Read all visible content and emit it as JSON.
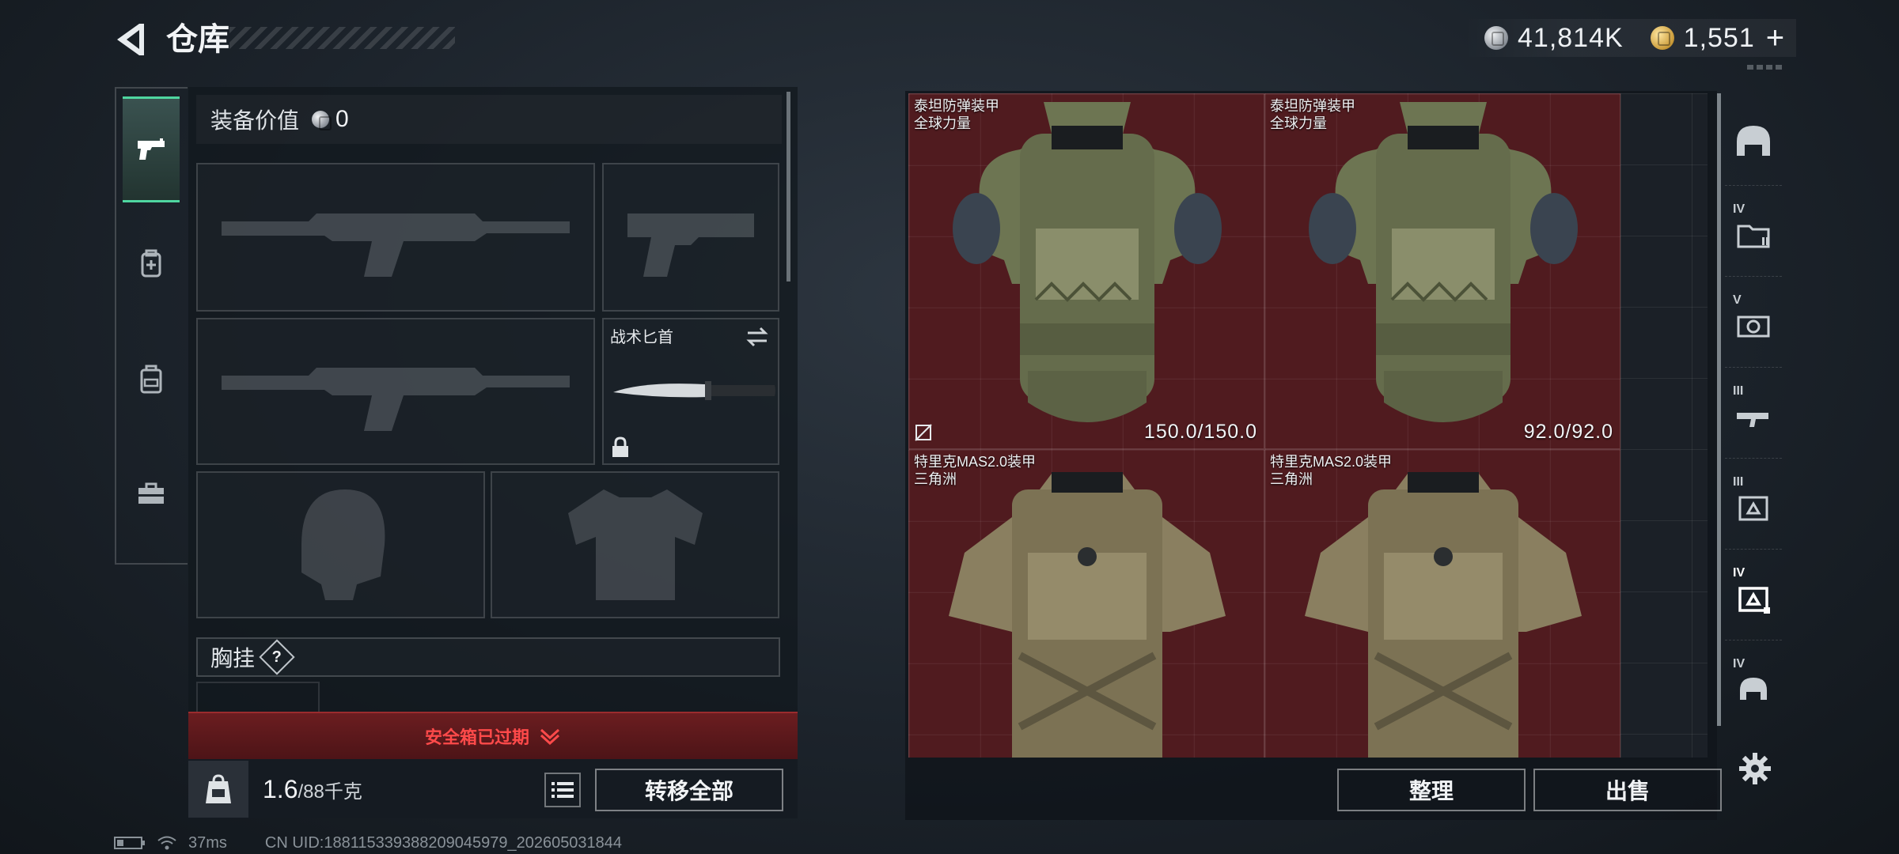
{
  "header": {
    "title": "仓库",
    "currency": [
      {
        "type": "silver-coin-icon",
        "amount": "41,814K"
      },
      {
        "type": "gold-coin-icon",
        "amount": "1,551"
      }
    ],
    "plus_label": "+"
  },
  "left_tabs": [
    {
      "name": "weapons",
      "icon": "pistol-icon",
      "active": true
    },
    {
      "name": "medical",
      "icon": "medkit-bag-icon",
      "active": false
    },
    {
      "name": "backpack",
      "icon": "backpack-icon",
      "active": false
    },
    {
      "name": "tools",
      "icon": "toolbox-icon",
      "active": false
    }
  ],
  "loadout": {
    "equip_value_label": "装备价值",
    "equip_value": "0",
    "knife_name": "战术匕首",
    "rig_label": "胸挂",
    "rig_help": "?",
    "safebox_text": "安全箱已过期",
    "weight_current": "1.6",
    "weight_max": "/88千克",
    "transfer_all_label": "转移全部"
  },
  "storage": {
    "items": [
      {
        "name_line1": "泰坦防弹装甲",
        "name_line2": "全球力量",
        "durability": "150.0/150.0",
        "uninsured": true
      },
      {
        "name_line1": "泰坦防弹装甲",
        "name_line2": "全球力量",
        "durability": "92.0/92.0",
        "uninsured": false
      },
      {
        "name_line1": "特里克MAS2.0装甲",
        "name_line2": "三角洲",
        "durability": "",
        "uninsured": false
      },
      {
        "name_line1": "特里克MAS2.0装甲",
        "name_line2": "三角洲",
        "durability": "",
        "uninsured": false
      }
    ],
    "sort_label": "整理",
    "sell_label": "出售"
  },
  "right_tabs": [
    {
      "tier": "",
      "icon": "helmet-filter-icon",
      "active": false
    },
    {
      "tier": "IV",
      "icon": "folder-filter-icon",
      "active": false
    },
    {
      "tier": "V",
      "icon": "camera-filter-icon",
      "active": false
    },
    {
      "tier": "III",
      "icon": "rifle-filter-icon",
      "active": false
    },
    {
      "tier": "III",
      "icon": "armor-filter-icon",
      "active": false
    },
    {
      "tier": "IV",
      "icon": "armor-filter-icon",
      "active": true
    },
    {
      "tier": "IV",
      "icon": "helmet-filter-icon",
      "active": false
    }
  ],
  "status": {
    "ping": "37ms",
    "uid": "CN UID:188115339388209045979_202605031844"
  },
  "colors": {
    "accent_green": "#4fd6a0",
    "item_bg_red": "#5f191e",
    "warning_red": "#ff4a4a"
  }
}
